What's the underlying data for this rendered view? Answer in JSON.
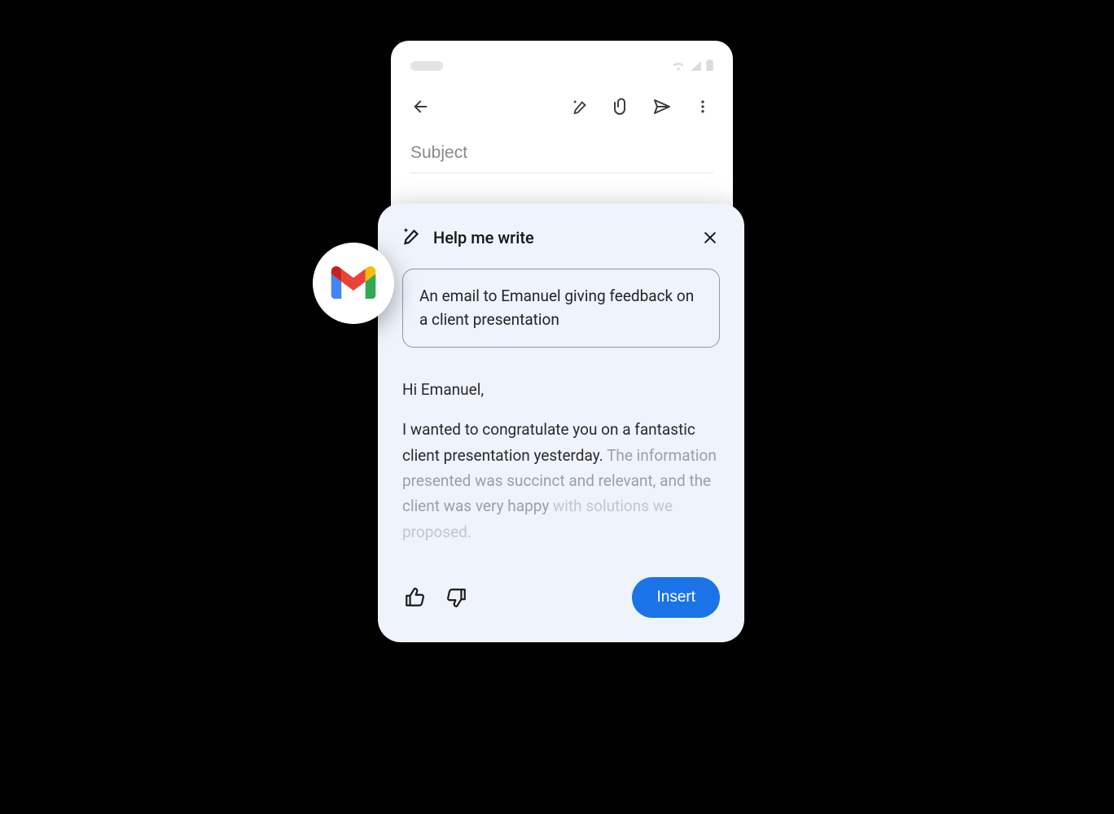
{
  "compose": {
    "subject_placeholder": "Subject"
  },
  "panel": {
    "title": "Help me write",
    "prompt": "An email to Emanuel giving feedback on a client presentation",
    "draft_greeting": "Hi Emanuel,",
    "draft_line1": "I wanted to congratulate you on a fantastic client presentation yesterday.",
    "draft_line2": "The information presented was succinct and relevant, and the client was very happy",
    "draft_line3": "with solutions we proposed.",
    "insert_label": "Insert"
  },
  "icons": {
    "back": "back-icon",
    "magic": "magic-pencil-icon",
    "attach": "attachment-icon",
    "send": "send-icon",
    "more": "more-vert-icon",
    "close": "close-icon",
    "thumb_up": "thumb-up-icon",
    "thumb_down": "thumb-down-icon",
    "gmail": "gmail-logo-icon",
    "wifi": "wifi-icon",
    "signal": "signal-icon",
    "battery": "battery-icon"
  }
}
